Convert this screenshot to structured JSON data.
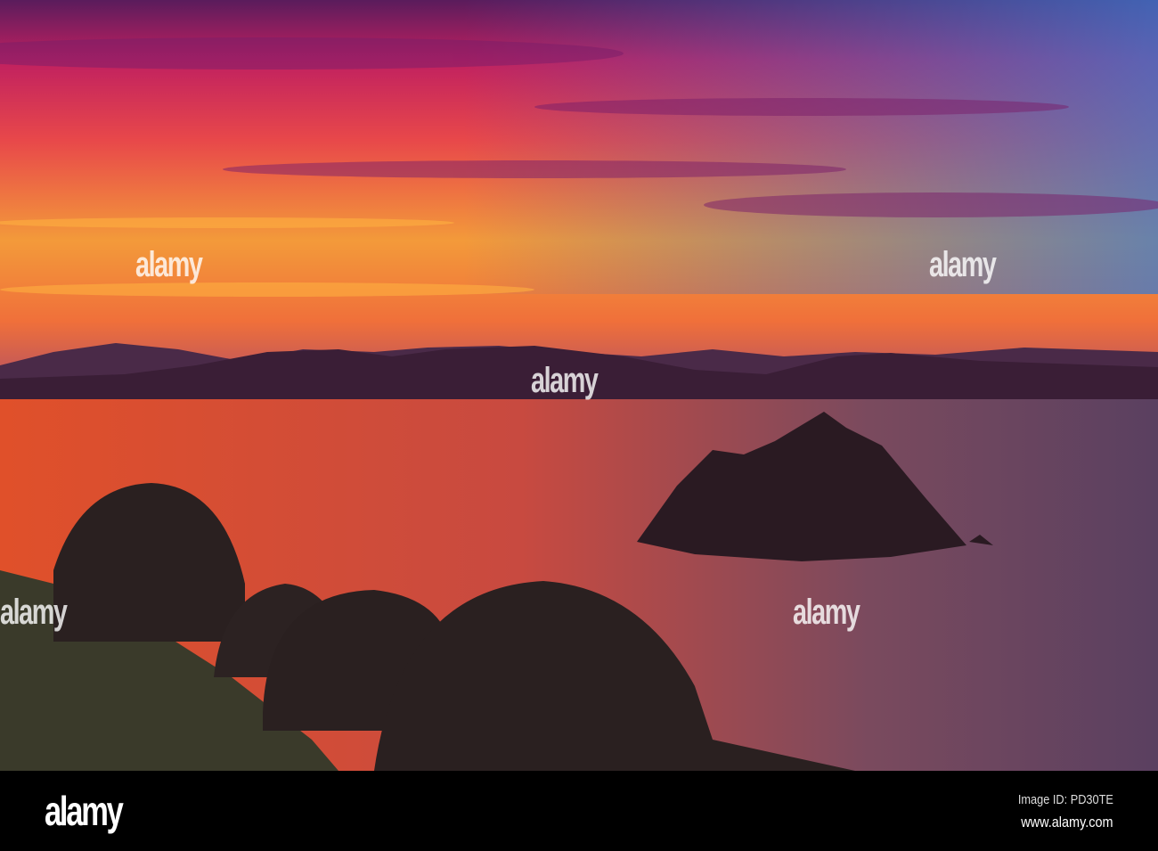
{
  "photo": {
    "subject": "Sunset over sea with islands and stone beehive huts"
  },
  "watermark": {
    "text": "alamy"
  },
  "footer": {
    "logo": "alamy",
    "image_id": "Image ID: PD30TE",
    "url": "www.alamy.com"
  }
}
